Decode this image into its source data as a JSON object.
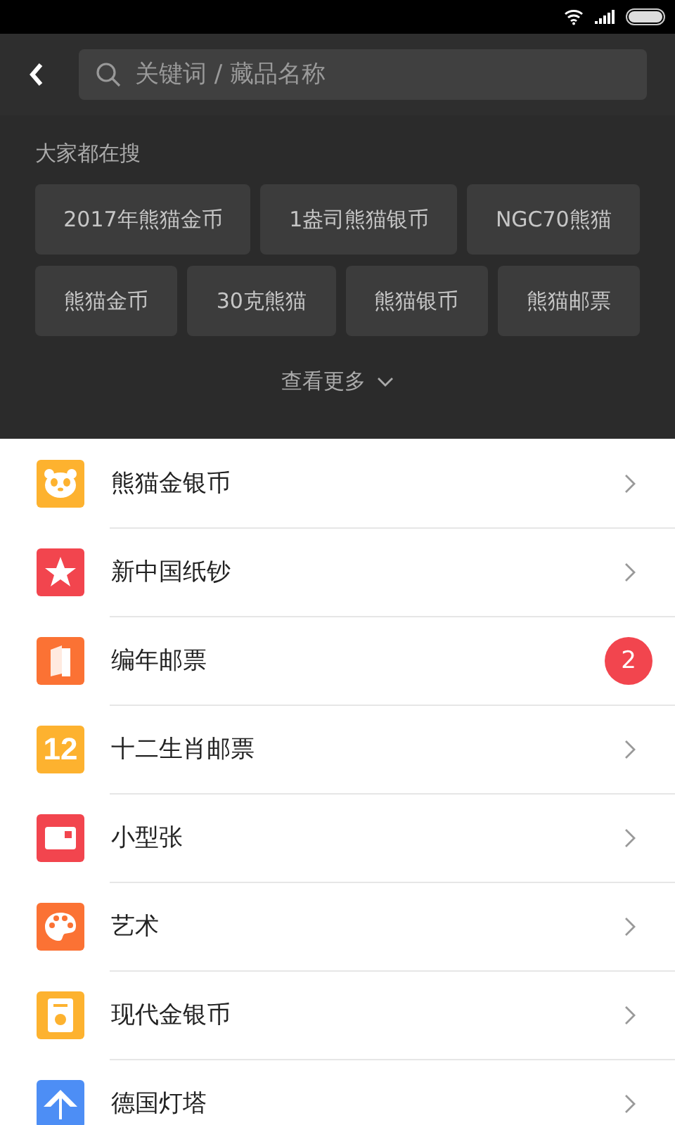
{
  "search": {
    "placeholder": "关键词 / 藏品名称"
  },
  "hot": {
    "title": "大家都在搜",
    "tags": [
      "2017年熊猫金币",
      "1盎司熊猫银币",
      "NGC70熊猫",
      "熊猫金币",
      "30克熊猫",
      "熊猫银币",
      "熊猫邮票"
    ],
    "more": "查看更多"
  },
  "categories": [
    {
      "label": "熊猫金银币",
      "kind": "panda",
      "color": "#fdb22f"
    },
    {
      "label": "新中国纸钞",
      "kind": "star",
      "color": "#f2454e"
    },
    {
      "label": "编年邮票",
      "kind": "book",
      "color": "#fb7234",
      "badge": "2"
    },
    {
      "label": "十二生肖邮票",
      "kind": "number",
      "color": "#fdb22f",
      "icon_text": "12"
    },
    {
      "label": "小型张",
      "kind": "sheet",
      "color": "#f2454e"
    },
    {
      "label": "艺术",
      "kind": "palette",
      "color": "#fb7234"
    },
    {
      "label": "现代金银币",
      "kind": "coin",
      "color": "#fdb22f"
    },
    {
      "label": "德国灯塔",
      "kind": "tent",
      "color": "#4d8ef5"
    }
  ]
}
